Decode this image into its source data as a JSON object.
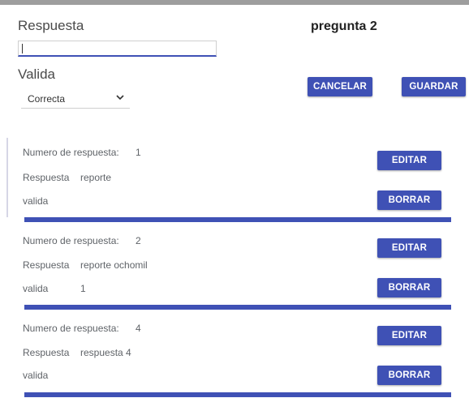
{
  "form": {
    "respuesta_label": "Respuesta",
    "respuesta_value": "",
    "valida_label": "Valida",
    "valida_selected": "Correcta"
  },
  "header": {
    "question_title": "pregunta 2"
  },
  "actions": {
    "cancel_label": "CANCELAR",
    "save_label": "GUARDAR"
  },
  "answers": [
    {
      "number_label": "Numero de respuesta:",
      "number": "1",
      "answer_label": "Respuesta",
      "answer_text": "reporte",
      "valid_label": "valida",
      "valid_value": "",
      "edit_label": "EDITAR",
      "delete_label": "BORRAR"
    },
    {
      "number_label": "Numero de respuesta:",
      "number": "2",
      "answer_label": "Respuesta",
      "answer_text": "reporte ochomil",
      "valid_label": "valida",
      "valid_value": "1",
      "edit_label": "EDITAR",
      "delete_label": "BORRAR"
    },
    {
      "number_label": "Numero de respuesta:",
      "number": "4",
      "answer_label": "Respuesta",
      "answer_text": "respuesta 4",
      "valid_label": "valida",
      "valid_value": "",
      "edit_label": "EDITAR",
      "delete_label": "BORRAR"
    }
  ],
  "colors": {
    "accent": "#3f51b5",
    "top_bar": "#9e9e9e"
  }
}
